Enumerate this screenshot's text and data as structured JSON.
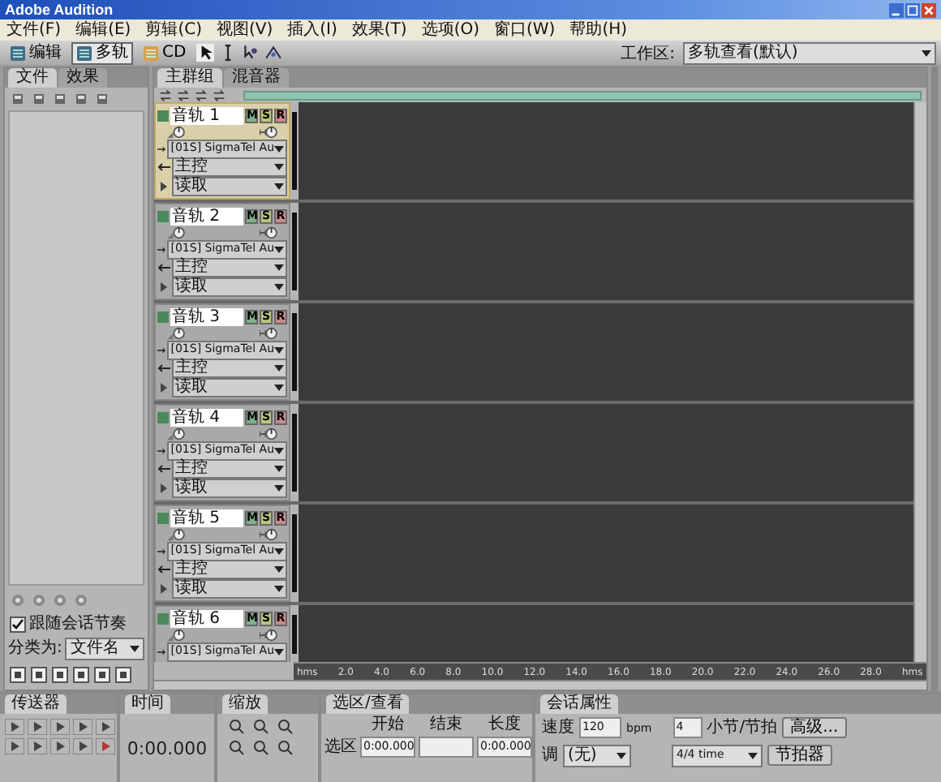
{
  "window": {
    "title": "Adobe Audition"
  },
  "menu": [
    "文件(F)",
    "编辑(E)",
    "剪辑(C)",
    "视图(V)",
    "插入(I)",
    "效果(T)",
    "选项(O)",
    "窗口(W)",
    "帮助(H)"
  ],
  "toolbar": {
    "modes": [
      {
        "label": "编辑",
        "selected": false
      },
      {
        "label": "多轨",
        "selected": true
      },
      {
        "label": "CD",
        "selected": false
      }
    ],
    "workspace_label": "工作区:",
    "workspace": "多轨查看(默认)"
  },
  "files_panel": {
    "tabs": [
      {
        "label": "文件",
        "selected": true
      },
      {
        "label": "效果",
        "selected": false
      }
    ],
    "follow_tempo": {
      "label": "跟随会话节奏",
      "checked": true
    },
    "sort_label": "分类为:",
    "sort_value": "文件名"
  },
  "main_panel": {
    "tabs": [
      {
        "label": "主群组",
        "selected": true
      },
      {
        "label": "混音器",
        "selected": false
      }
    ],
    "tracks": [
      {
        "name": "音轨 1",
        "selected": true,
        "buttons": [
          "M",
          "S",
          "R"
        ],
        "input": "[01S] SigmaTel Au",
        "output": "主控",
        "automation": "读取"
      },
      {
        "name": "音轨 2",
        "selected": false,
        "buttons": [
          "M",
          "S",
          "R"
        ],
        "input": "[01S] SigmaTel Au",
        "output": "主控",
        "automation": "读取"
      },
      {
        "name": "音轨 3",
        "selected": false,
        "buttons": [
          "M",
          "S",
          "R"
        ],
        "input": "[01S] SigmaTel Au",
        "output": "主控",
        "automation": "读取"
      },
      {
        "name": "音轨 4",
        "selected": false,
        "buttons": [
          "M",
          "S",
          "R"
        ],
        "input": "[01S] SigmaTel Au",
        "output": "主控",
        "automation": "读取"
      },
      {
        "name": "音轨 5",
        "selected": false,
        "buttons": [
          "M",
          "S",
          "R"
        ],
        "input": "[01S] SigmaTel Au",
        "output": "主控",
        "automation": "读取"
      },
      {
        "name": "音轨 6",
        "selected": false,
        "buttons": [
          "M",
          "S",
          "R"
        ],
        "input": "[01S] SigmaTel Au"
      }
    ],
    "ruler": [
      "hms",
      "2.0",
      "4.0",
      "6.0",
      "8.0",
      "10.0",
      "12.0",
      "14.0",
      "16.0",
      "18.0",
      "20.0",
      "22.0",
      "24.0",
      "26.0",
      "28.0",
      "hms"
    ]
  },
  "transport": {
    "title": "传送器"
  },
  "time": {
    "title": "时间",
    "value": "0:00.000"
  },
  "zoom": {
    "title": "缩放"
  },
  "selection": {
    "title": "选区/查看",
    "columns": [
      "开始",
      "结束",
      "长度"
    ],
    "row_label": "选区",
    "start": "0:00.000",
    "length": "0:00.000"
  },
  "session": {
    "title": "会话属性",
    "tempo_label": "速度",
    "tempo": "120",
    "tempo_unit": "bpm",
    "beats": "4",
    "beats_label": "小节/节拍",
    "advanced": "高级...",
    "key_label": "调",
    "key": "(无)",
    "time_sig": "4/4 time",
    "metronome": "节拍器"
  }
}
